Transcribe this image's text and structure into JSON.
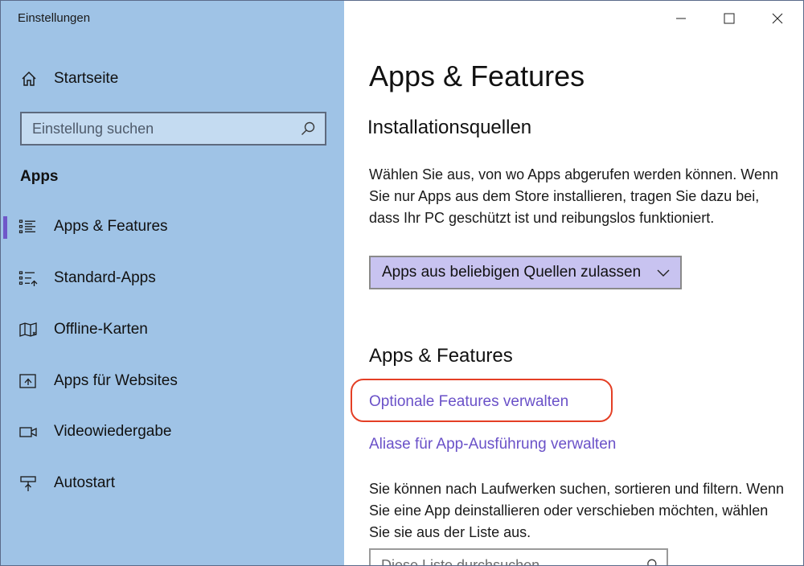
{
  "window": {
    "title": "Einstellungen",
    "controls": [
      "minimize",
      "maximize",
      "close"
    ]
  },
  "sidebar": {
    "home_label": "Startseite",
    "search_placeholder": "Einstellung suchen",
    "section_label": "Apps",
    "items": [
      {
        "label": "Apps & Features",
        "icon": "apps-features-list-icon",
        "selected": true
      },
      {
        "label": "Standard-Apps",
        "icon": "default-apps-icon",
        "selected": false
      },
      {
        "label": "Offline-Karten",
        "icon": "map-icon",
        "selected": false
      },
      {
        "label": "Apps für Websites",
        "icon": "apps-websites-icon",
        "selected": false
      },
      {
        "label": "Videowiedergabe",
        "icon": "video-playback-icon",
        "selected": false
      },
      {
        "label": "Autostart",
        "icon": "startup-icon",
        "selected": false
      }
    ]
  },
  "main": {
    "title": "Apps & Features",
    "install_sources": {
      "heading": "Installationsquellen",
      "description": "Wählen Sie aus, von wo Apps abgerufen werden können. Wenn Sie nur Apps aus dem Store installieren, tragen Sie dazu bei, dass Ihr PC geschützt ist und reibungslos funktioniert.",
      "dropdown_value": "Apps aus beliebigen Quellen zulassen"
    },
    "apps_features": {
      "heading": "Apps & Features",
      "link_optional": "Optionale Features verwalten",
      "link_aliases": "Aliase für App-Ausführung verwalten",
      "description": "Sie können nach Laufwerken suchen, sortieren und filtern. Wenn Sie eine App deinstallieren oder verschieben möchten, wählen Sie sie aus der Liste aus.",
      "list_search_placeholder": "Diese Liste durchsuchen"
    }
  },
  "colors": {
    "sidebar_bg": "#9fc3e6",
    "accent": "#6a51c8",
    "dropdown_bg": "#c8c3f0",
    "highlight": "#e43f25"
  }
}
